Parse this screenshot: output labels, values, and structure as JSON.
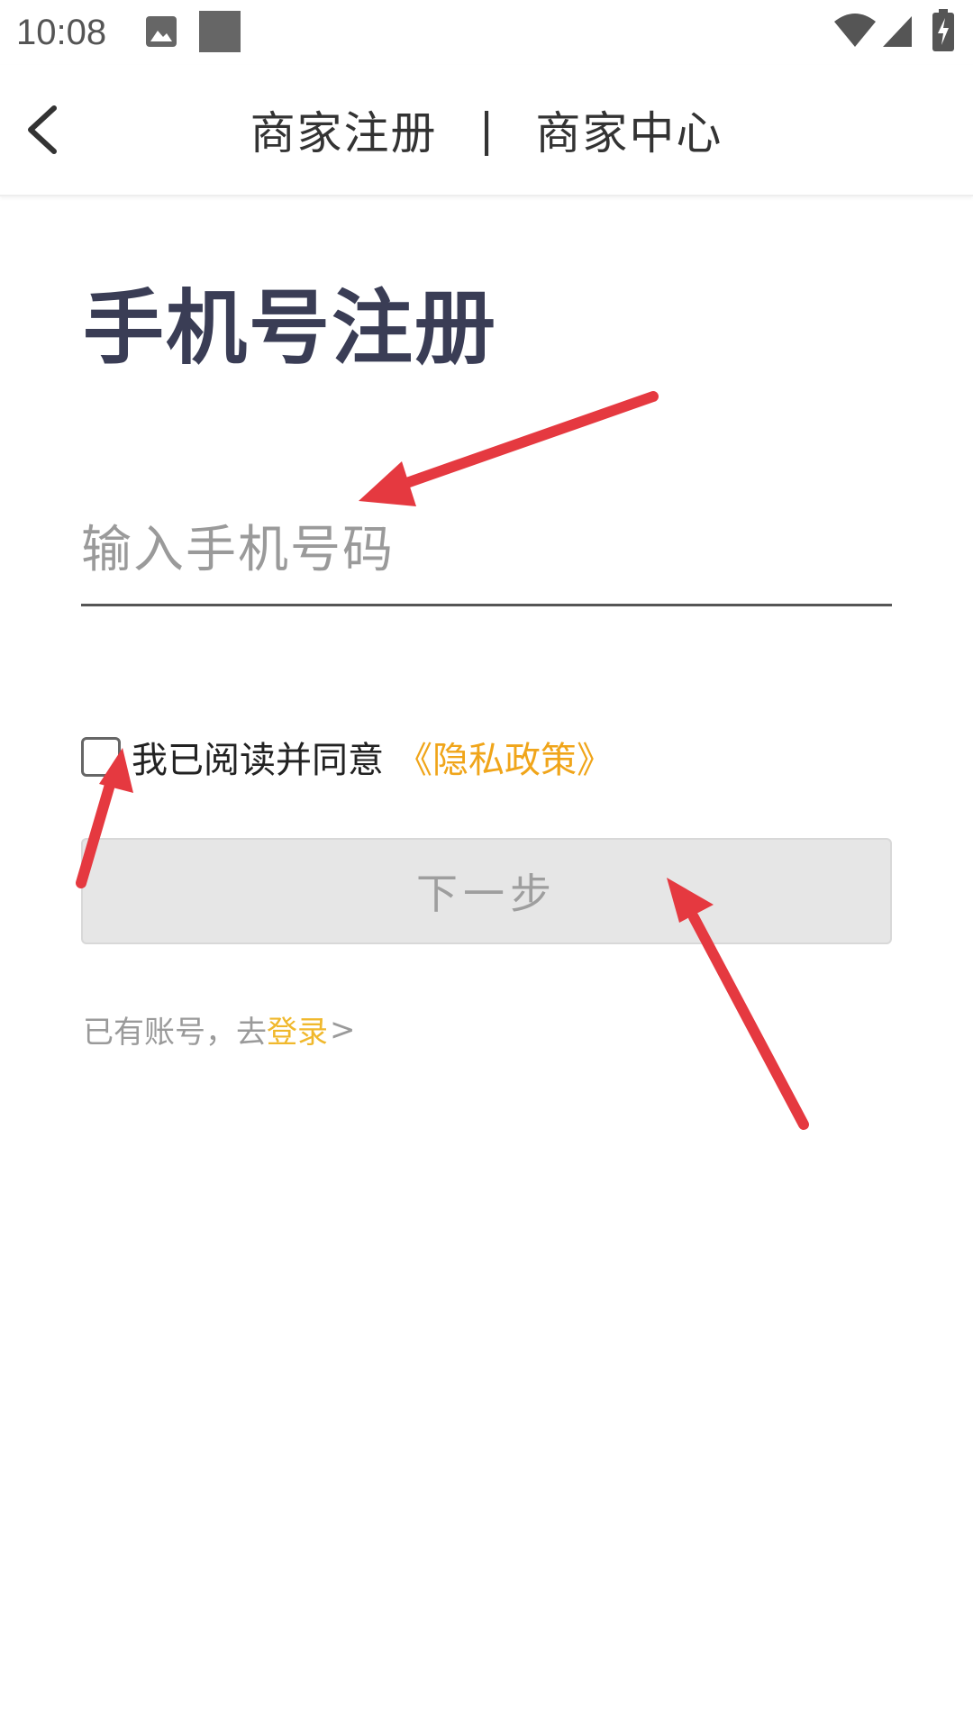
{
  "status_bar": {
    "time": "10:08",
    "icons": [
      "image-icon",
      "square-icon",
      "wifi-icon",
      "signal-icon",
      "battery-charging-icon"
    ]
  },
  "header": {
    "back_icon": "chevron-left-icon",
    "tab_register": "商家注册",
    "separator": "|",
    "tab_center": "商家中心"
  },
  "form": {
    "title": "手机号注册",
    "phone_placeholder": "输入手机号码",
    "phone_value": "",
    "agree_text": "我已阅读并同意",
    "agree_checked": false,
    "privacy_link": "《隐私政策》",
    "next_button": "下一步"
  },
  "login": {
    "prompt": "已有账号，去",
    "link": "登录",
    "arrow": ">"
  },
  "colors": {
    "title": "#3a3d55",
    "link_orange": "#f0a51a",
    "login_yellow": "#f0b82c",
    "button_disabled_bg": "#e6e6e6",
    "annotation_red": "#e53940"
  }
}
